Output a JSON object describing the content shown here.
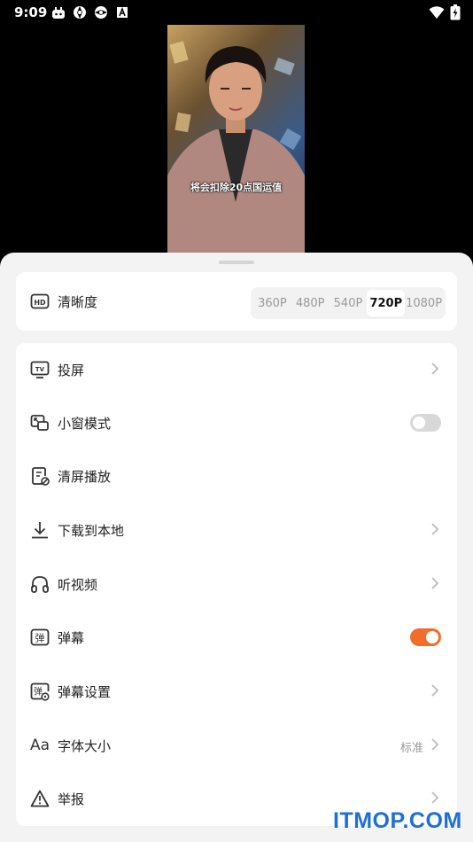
{
  "status_bar": {
    "time": "9:09",
    "icons": [
      "app-icon",
      "aperture-icon",
      "aperture-icon",
      "a-box-icon"
    ],
    "right_icons": [
      "wifi-icon",
      "battery-icon"
    ]
  },
  "video": {
    "subtitle": "将会扣除20点国运值"
  },
  "quality": {
    "label": "清晰度",
    "icon": "hd-icon",
    "options": [
      "360P",
      "480P",
      "540P",
      "720P",
      "1080P"
    ],
    "selected": "720P"
  },
  "options": [
    {
      "name": "cast",
      "icon": "tv-icon",
      "label": "投屏",
      "control": "chevron"
    },
    {
      "name": "pip",
      "icon": "pip-window-icon",
      "label": "小窗模式",
      "control": "toggle",
      "state": "off"
    },
    {
      "name": "clear-screen",
      "icon": "clear-screen-icon",
      "label": "清屏播放",
      "control": "none"
    },
    {
      "name": "download",
      "icon": "download-icon",
      "label": "下载到本地",
      "control": "chevron"
    },
    {
      "name": "listen",
      "icon": "headphones-icon",
      "label": "听视频",
      "control": "chevron"
    },
    {
      "name": "danmaku",
      "icon": "danmaku-icon",
      "label": "弹幕",
      "control": "toggle",
      "state": "on"
    },
    {
      "name": "danmaku-settings",
      "icon": "danmaku-settings-icon",
      "label": "弹幕设置",
      "control": "chevron"
    },
    {
      "name": "font-size",
      "icon": "font-size-icon",
      "label": "字体大小",
      "control": "chevron",
      "value": "标准",
      "icon_text": "Aa"
    },
    {
      "name": "report",
      "icon": "warning-icon",
      "label": "举报",
      "control": "chevron"
    }
  ],
  "watermark": "ITMOP.COM",
  "colors": {
    "accent": "#f26d2d",
    "toggle_off": "#d8d8d8",
    "sheet_bg": "#f3f3f3",
    "card_bg": "#ffffff",
    "watermark": "#1e6fd6"
  }
}
